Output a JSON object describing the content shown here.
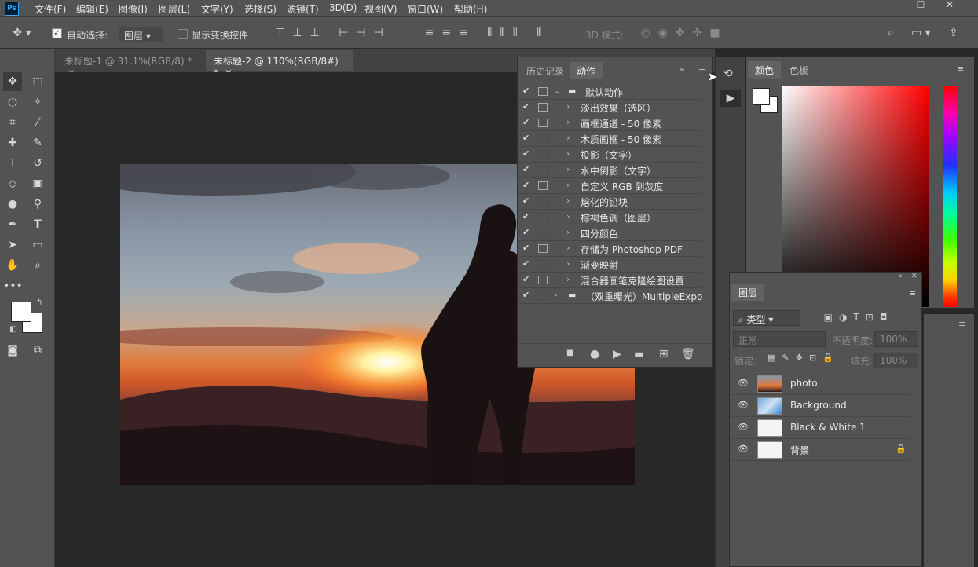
{
  "menu": [
    "文件(F)",
    "编辑(E)",
    "图像(I)",
    "图层(L)",
    "文字(Y)",
    "选择(S)",
    "滤镜(T)",
    "3D(D)",
    "视图(V)",
    "窗口(W)",
    "帮助(H)"
  ],
  "logo_text": "Ps",
  "options": {
    "auto_select_label": "自动选择:",
    "auto_select_value": "图层",
    "show_transform_label": "显示变换控件",
    "mode_3d_label": "3D 模式:"
  },
  "tabs": [
    {
      "label": "未标题-1 @ 31.1%(RGB/8) *",
      "active": false
    },
    {
      "label": "未标题-2 @ 110%(RGB/8#) *",
      "active": true
    }
  ],
  "actions_panel": {
    "tabs": [
      "历史记录",
      "动作"
    ],
    "rows": [
      {
        "label": "默认动作",
        "checked": true,
        "dialog": true,
        "folder": true,
        "expanded": true
      },
      {
        "label": "淡出效果（选区）",
        "checked": true,
        "dialog": true
      },
      {
        "label": "画框通道 - 50 像素",
        "checked": true,
        "dialog": true
      },
      {
        "label": "木质画框 - 50 像素",
        "checked": true,
        "dialog": false
      },
      {
        "label": "投影（文字）",
        "checked": true,
        "dialog": false
      },
      {
        "label": "水中倒影（文字）",
        "checked": true,
        "dialog": false
      },
      {
        "label": "自定义 RGB 到灰度",
        "checked": true,
        "dialog": true
      },
      {
        "label": "熔化的铅块",
        "checked": true,
        "dialog": false
      },
      {
        "label": "棕褐色调（图层）",
        "checked": true,
        "dialog": false
      },
      {
        "label": "四分颜色",
        "checked": true,
        "dialog": false
      },
      {
        "label": "存储为 Photoshop PDF",
        "checked": true,
        "dialog": true
      },
      {
        "label": "渐变映射",
        "checked": true,
        "dialog": false
      },
      {
        "label": "混合器画笔克隆绘图设置",
        "checked": true,
        "dialog": true
      },
      {
        "label": "（双重曝光）MultipleExpo...",
        "checked": true,
        "dialog": false,
        "folder": true
      }
    ]
  },
  "color_panel": {
    "tabs": [
      "颜色",
      "色板"
    ]
  },
  "layers_panel": {
    "tab": "图层",
    "filter_label": "类型",
    "blend_mode": "正常",
    "opacity_label": "不透明度:",
    "opacity_value": "100%",
    "lock_label": "锁定:",
    "fill_label": "填充:",
    "fill_value": "100%",
    "layers": [
      {
        "name": "photo",
        "locked": false
      },
      {
        "name": "Background",
        "locked": false
      },
      {
        "name": "Black & White 1",
        "locked": false
      },
      {
        "name": "背景",
        "locked": true
      }
    ]
  },
  "colors": {
    "ui_bg": "#535353",
    "dark": "#282828",
    "accent": "#31a8ff"
  }
}
